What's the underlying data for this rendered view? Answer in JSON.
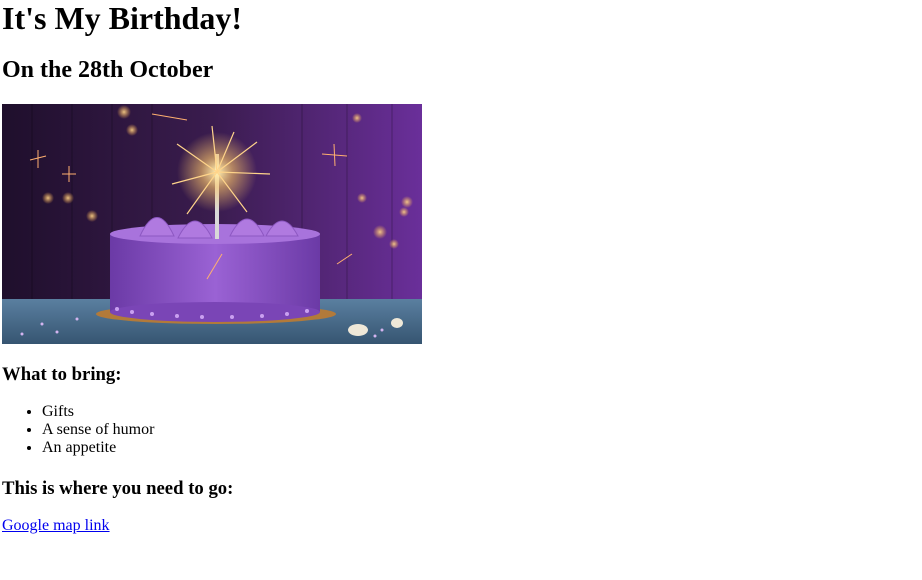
{
  "page": {
    "title": "It's My Birthday!",
    "date_heading": "On the 28th October",
    "bring_heading": "What to bring:",
    "bring_items": [
      "Gifts",
      "A sense of humor",
      "An appetite"
    ],
    "go_heading": "This is where you need to go:",
    "map_link_text": "Google map link"
  },
  "image": {
    "subject": "purple birthday cake with sparkler",
    "colors": {
      "background": "#2a1436",
      "cake": "#8a4fc4",
      "table": "#4a6d8c",
      "sparkle": "#ffcf7a"
    }
  },
  "colors": {
    "link": "#0000ee",
    "text": "#000000"
  }
}
